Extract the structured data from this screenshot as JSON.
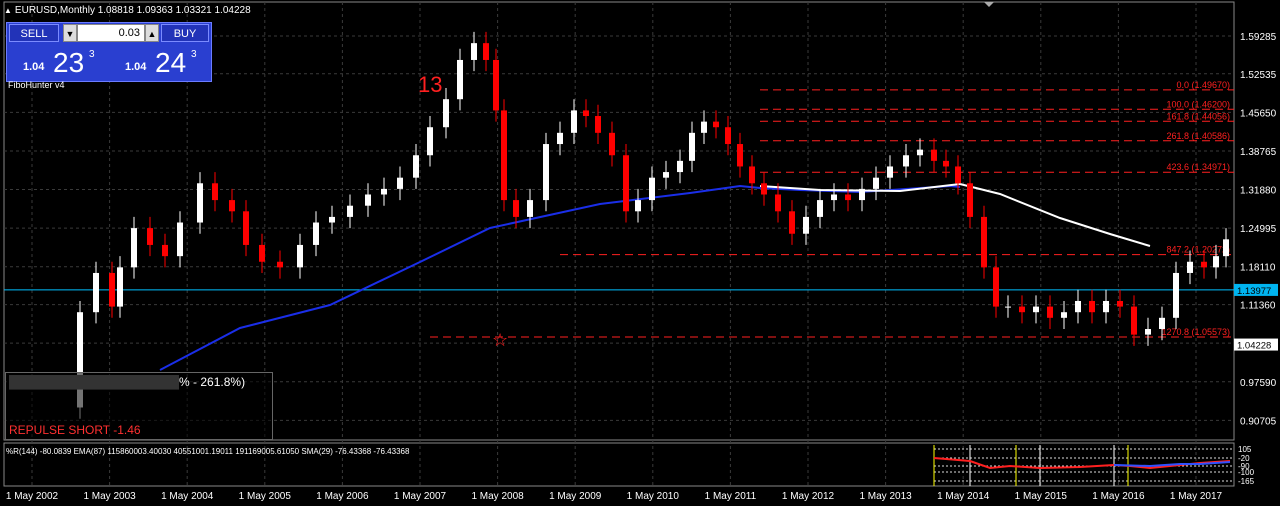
{
  "header": {
    "text": "EURUSD,Monthly  1.08818 1.09363 1.03321 1.04228"
  },
  "trade_panel": {
    "sell_label": "SELL",
    "buy_label": "BUY",
    "lot": "0.03",
    "sell_small": "1.04",
    "sell_big": "23",
    "sell_sup": "3",
    "buy_small": "1.04",
    "buy_big": "24",
    "buy_sup": "3"
  },
  "indicator_name": "FiboHunter v4",
  "panel": {
    "line1_visible": "% - 261.8%)",
    "signal": "REPULSE SHORT -1.46"
  },
  "subwindow_header": "%R(144) -80.0839  EMA(87) 115860003.40030 40551001.19011 191169005.61050  SMA(29) -76.43368 -76.43368",
  "annotations": {
    "wave_count": "13"
  },
  "colors": {
    "bull": "#ffffff",
    "bear": "#ff0000",
    "ema": "#1a2ee8",
    "sma": "#ffffff",
    "hline": "#00c0ff",
    "fibo": "#ff2020",
    "grid": "#3a3a3a"
  },
  "chart_data": {
    "type": "candlestick",
    "symbol": "EURUSD",
    "timeframe": "Monthly",
    "ohlc_current": {
      "open": 1.08818,
      "high": 1.09363,
      "low": 1.03321,
      "close": 1.04228
    },
    "y_ticks": [
      "1.59285",
      "1.52535",
      "1.45650",
      "1.38765",
      "1.31880",
      "1.24995",
      "1.18110",
      "1.11360",
      "1.04475",
      "0.97590",
      "0.90705"
    ],
    "x_ticks": [
      "1 May 2002",
      "1 May 2003",
      "1 May 2004",
      "1 May 2005",
      "1 May 2006",
      "1 May 2007",
      "1 May 2008",
      "1 May 2009",
      "1 May 2010",
      "1 May 2011",
      "1 May 2012",
      "1 May 2013",
      "1 May 2014",
      "1 May 2015",
      "1 May 2016",
      "1 May 2017"
    ],
    "price_marks": [
      {
        "label": "1.13977",
        "value": 1.13977
      },
      {
        "label": "1.04228",
        "value": 1.04228
      }
    ],
    "fibo_levels": [
      {
        "label": "0.0  (1.49670)",
        "value": 1.4967
      },
      {
        "label": "100.0  (1.46200)",
        "value": 1.462
      },
      {
        "label": "161.8  (1.44056)",
        "value": 1.44056
      },
      {
        "label": "261.8  (1.40586)",
        "value": 1.40586
      },
      {
        "label": "423.6  (1.34971)",
        "value": 1.34971
      },
      {
        "label": "847.2  (1.20272)",
        "value": 1.20272
      },
      {
        "label": "1270.8  (1.05573)",
        "value": 1.05573
      }
    ],
    "sub_ticks": [
      "105",
      "-20",
      "-90",
      "-100",
      "-165"
    ],
    "ylim": [
      0.872,
      1.632
    ]
  }
}
